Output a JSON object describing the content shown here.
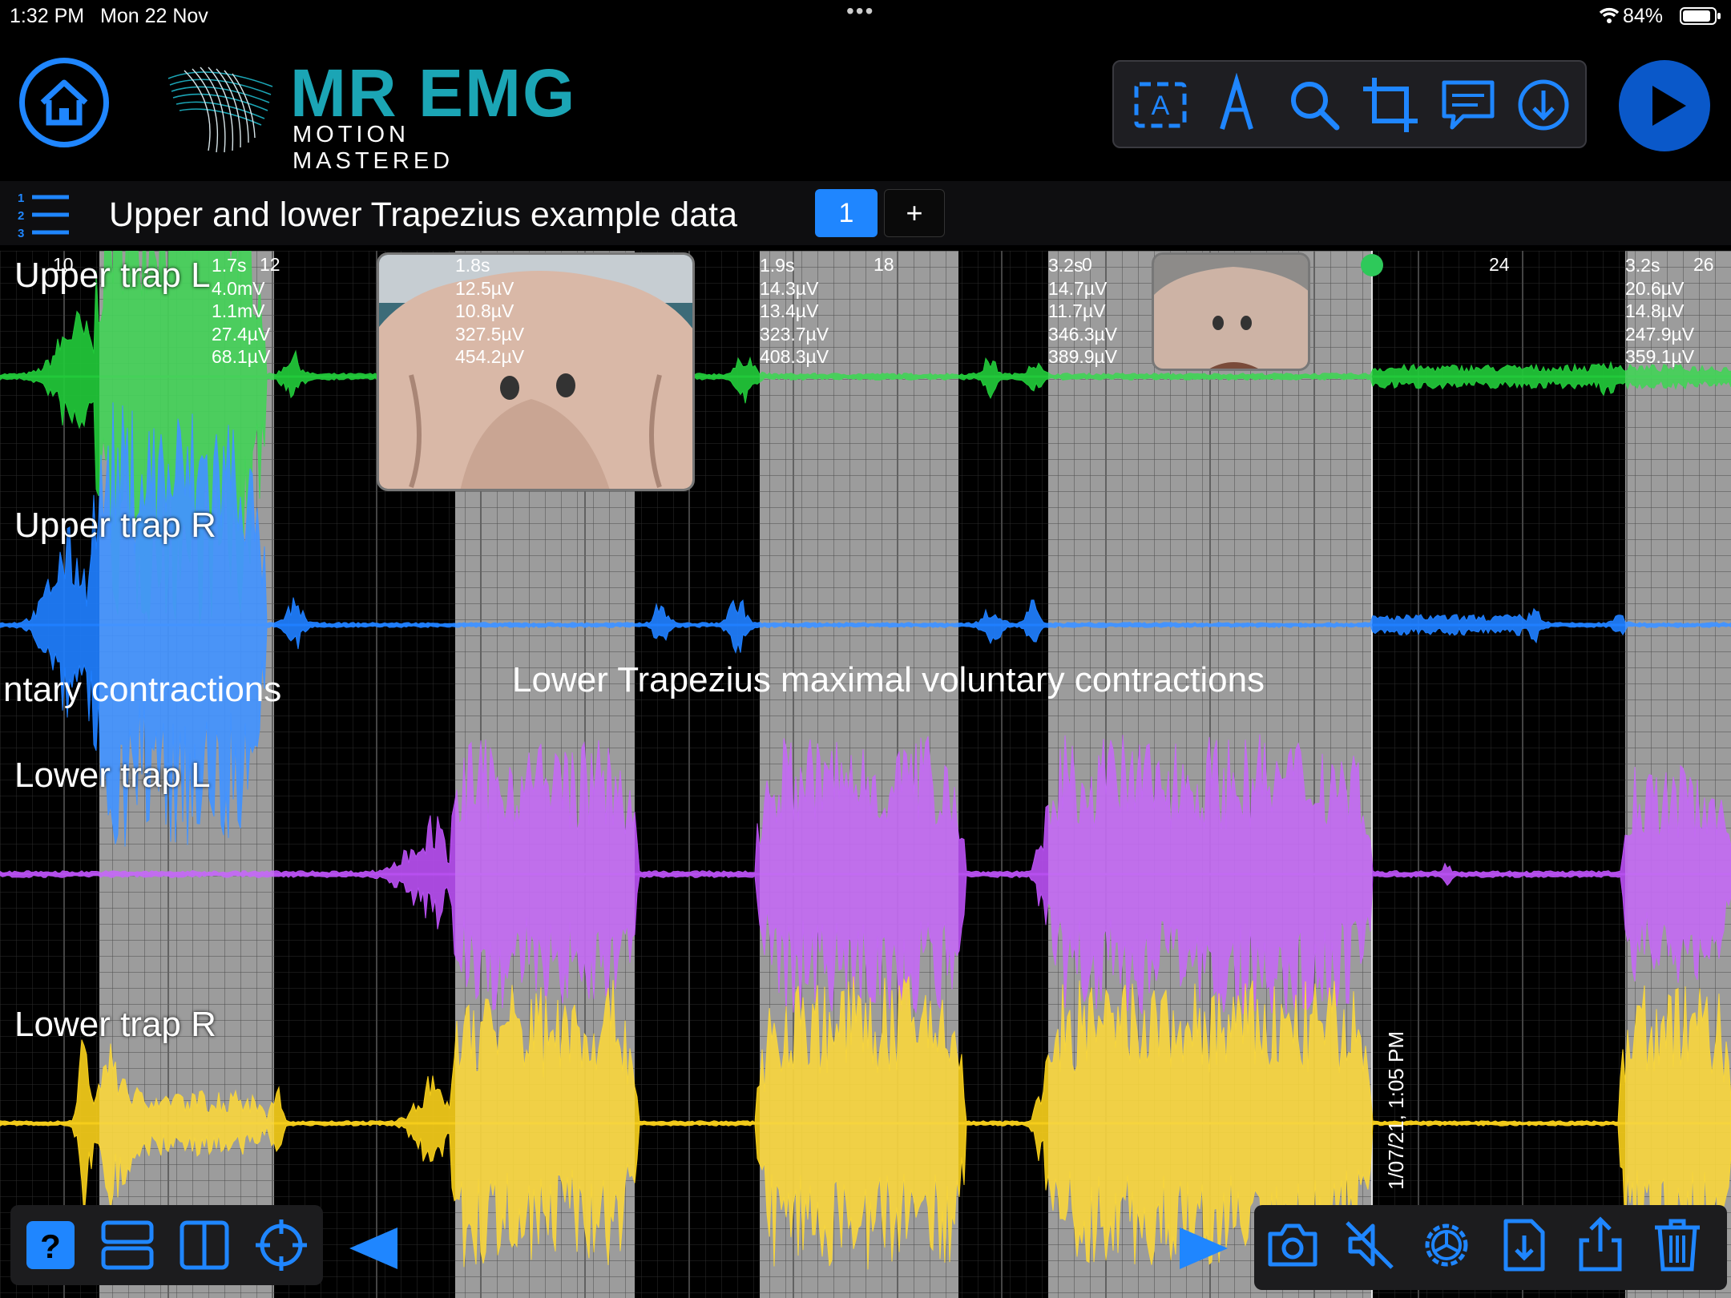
{
  "status_bar": {
    "time": "1:32 PM",
    "date": "Mon 22 Nov",
    "battery": "84%"
  },
  "header": {
    "logo_title": "MR EMG",
    "logo_subtitle": "MOTION MASTERED",
    "toolbar_icons": [
      "text-annotation-icon",
      "marker-icon",
      "search-icon",
      "crop-icon",
      "comment-icon",
      "download-icon"
    ]
  },
  "title_bar": {
    "title": "Upper and lower Trapezius example data",
    "active_page": "1",
    "add_page": "+"
  },
  "plot": {
    "time_ticks": [
      "10",
      "12",
      "18",
      "0",
      "24",
      "26"
    ],
    "channels": [
      {
        "name": "Upper trap L",
        "color": "#22c93a"
      },
      {
        "name": "Upper trap R",
        "color": "#1f7fff"
      },
      {
        "name": "Lower trap L",
        "color": "#b74ff0"
      },
      {
        "name": "Lower trap R",
        "color": "#f5cd1a"
      }
    ],
    "segments": [
      {
        "duration": "1.7s",
        "values": [
          "4.0mV",
          "1.1mV",
          "27.4µV",
          "68.1µV"
        ]
      },
      {
        "duration": "1.8s",
        "values": [
          "12.5µV",
          "10.8µV",
          "327.5µV",
          "454.2µV"
        ]
      },
      {
        "duration": "1.9s",
        "values": [
          "14.3µV",
          "13.4µV",
          "323.7µV",
          "408.3µV"
        ]
      },
      {
        "duration": "3.2s",
        "values": [
          "14.7µV",
          "11.7µV",
          "346.3µV",
          "389.9µV"
        ]
      },
      {
        "duration": "3.2s",
        "values": [
          "20.6µV",
          "14.8µV",
          "247.9µV",
          "359.1µV"
        ]
      }
    ],
    "annotations": {
      "upper_annotation": "ntary contractions",
      "lower_annotation": "Lower Trapezius maximal voluntary contractions",
      "recording_timestamp": "1/07/21, 1:05 PM"
    }
  },
  "bottom_left_icons": [
    "help-icon",
    "stacked-view-icon",
    "split-view-icon",
    "crosshair-icon",
    "previous-arrow-icon"
  ],
  "bottom_right_icons": [
    "next-arrow-icon",
    "camera-icon",
    "mute-icon",
    "settings-icon",
    "import-icon",
    "share-icon",
    "trash-icon"
  ]
}
